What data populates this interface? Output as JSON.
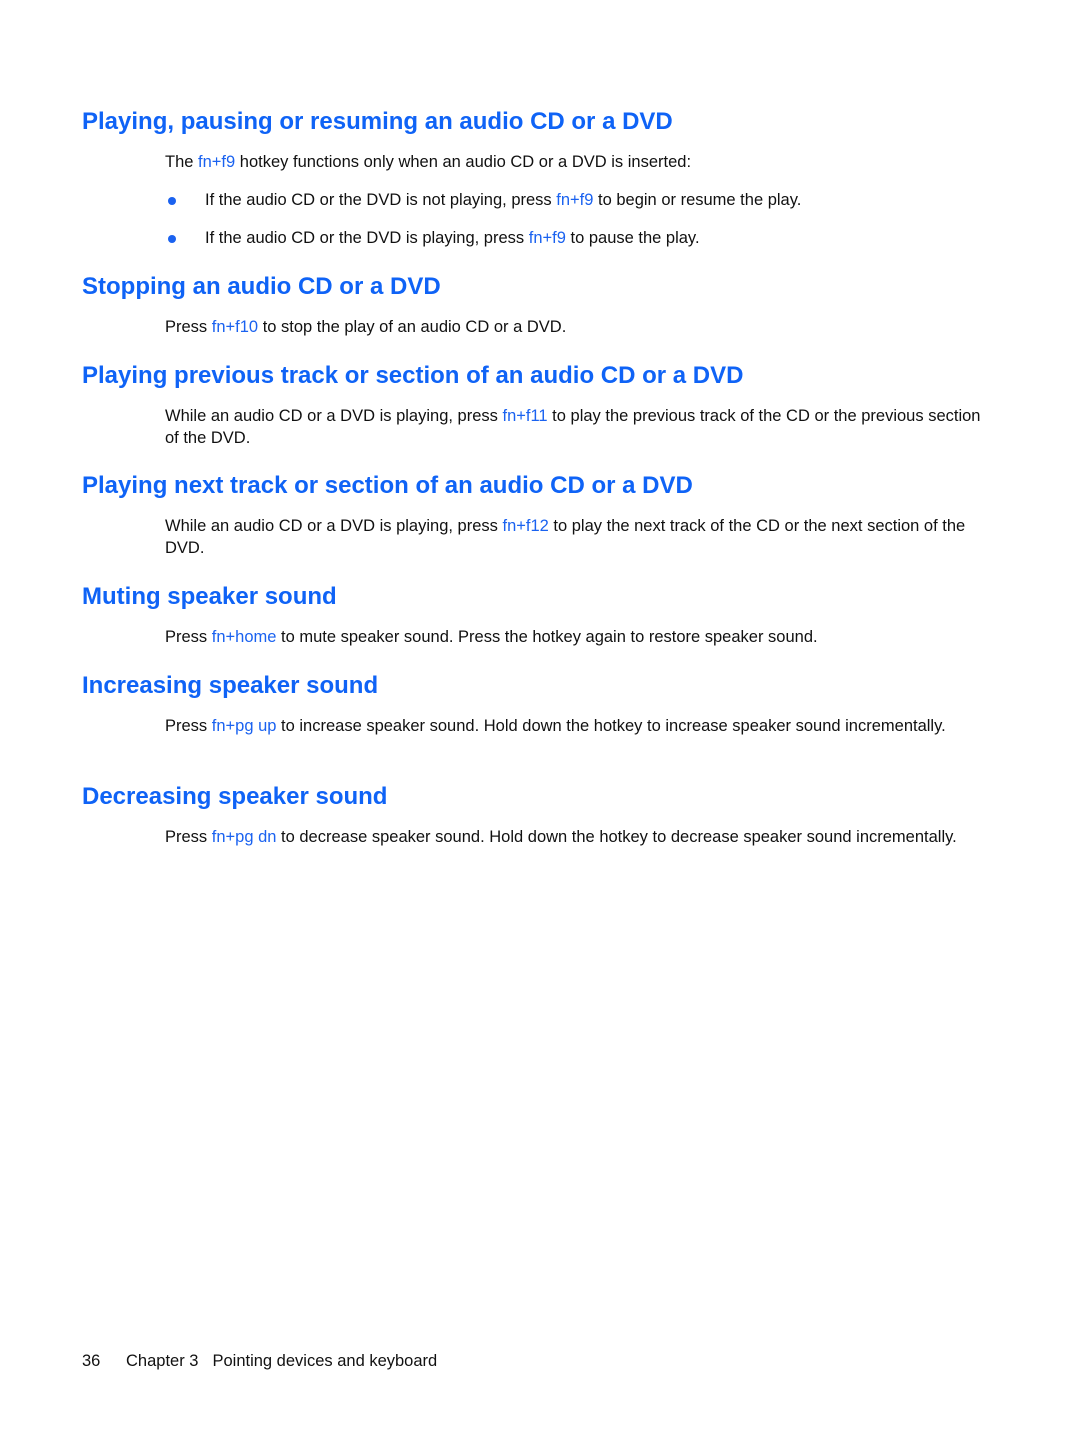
{
  "accent_color": "#0f63f6",
  "sections": [
    {
      "heading": "Playing, pausing or resuming an audio CD or a DVD",
      "intro": {
        "before": "The ",
        "hotkey": "fn+f9",
        "after": " hotkey functions only when an audio CD or a DVD is inserted:"
      },
      "bullets": [
        {
          "before": "If the audio CD or the DVD is not playing, press ",
          "hotkey": "fn+f9",
          "after": " to begin or resume the play."
        },
        {
          "before": "If the audio CD or the DVD is playing, press ",
          "hotkey": "fn+f9",
          "after": " to pause the play."
        }
      ]
    },
    {
      "heading": "Stopping an audio CD or a DVD",
      "body": {
        "before": "Press ",
        "hotkey": "fn+f10",
        "after": " to stop the play of an audio CD or a DVD."
      }
    },
    {
      "heading": "Playing previous track or section of an audio CD or a DVD",
      "body": {
        "before": "While an audio CD or a DVD is playing, press ",
        "hotkey": "fn+f11",
        "after": " to play the previous track of the CD or the previous section of the DVD."
      }
    },
    {
      "heading": "Playing next track or section of an audio CD or a DVD",
      "body": {
        "before": "While an audio CD or a DVD is playing, press ",
        "hotkey": "fn+f12",
        "after": " to play the next track of the CD or the next section of the DVD."
      }
    },
    {
      "heading": "Muting speaker sound",
      "body": {
        "before": "Press ",
        "hotkey": "fn+home",
        "after": " to mute speaker sound. Press the hotkey again to restore speaker sound."
      }
    },
    {
      "heading": "Increasing speaker sound",
      "body": {
        "before": "Press ",
        "hotkey": "fn+pg up",
        "after": " to increase speaker sound. Hold down the hotkey to increase speaker sound incrementally."
      }
    },
    {
      "heading": "Decreasing speaker sound",
      "body": {
        "before": "Press ",
        "hotkey": "fn+pg dn",
        "after": " to decrease speaker sound. Hold down the hotkey to decrease speaker sound incrementally."
      }
    }
  ],
  "footer": {
    "page_number": "36",
    "chapter": "Chapter 3",
    "chapter_title": "Pointing devices and keyboard"
  }
}
